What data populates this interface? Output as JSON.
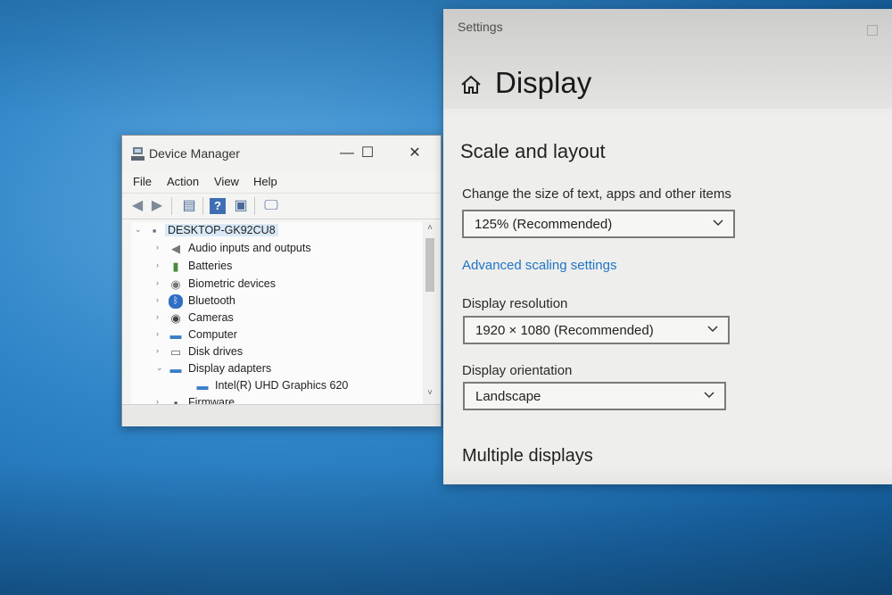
{
  "device_manager": {
    "title": "Device Manager",
    "window_buttons": {
      "minimize": "—",
      "maximize": "☐",
      "close": "✕"
    },
    "menu": [
      "File",
      "Action",
      "View",
      "Help"
    ],
    "tree": {
      "root": "DESKTOP-GK92CU8",
      "items": [
        {
          "label": "Audio inputs and outputs",
          "icon": "speaker-icon",
          "expanded": false
        },
        {
          "label": "Batteries",
          "icon": "battery-icon",
          "expanded": false
        },
        {
          "label": "Biometric devices",
          "icon": "fingerprint-icon",
          "expanded": false
        },
        {
          "label": "Bluetooth",
          "icon": "bluetooth-icon",
          "expanded": false
        },
        {
          "label": "Cameras",
          "icon": "camera-icon",
          "expanded": false
        },
        {
          "label": "Computer",
          "icon": "monitor-icon",
          "expanded": false
        },
        {
          "label": "Disk drives",
          "icon": "disk-icon",
          "expanded": false
        },
        {
          "label": "Display adapters",
          "icon": "display-adapter-icon",
          "expanded": true
        },
        {
          "label": "Intel(R) UHD Graphics 620",
          "icon": "display-adapter-icon",
          "child": true
        },
        {
          "label": "Firmware",
          "icon": "firmware-icon",
          "expanded": false
        }
      ]
    }
  },
  "settings": {
    "window_title": "Settings",
    "page_title": "Display",
    "section_scale": "Scale and layout",
    "scale_label": "Change the size of text, apps and other items",
    "scale_value": "125% (Recommended)",
    "advanced_link": "Advanced scaling settings",
    "resolution_label": "Display resolution",
    "resolution_value": "1920 × 1080 (Recommended)",
    "orientation_label": "Display orientation",
    "orientation_value": "Landscape",
    "section_multiple": "Multiple displays"
  }
}
